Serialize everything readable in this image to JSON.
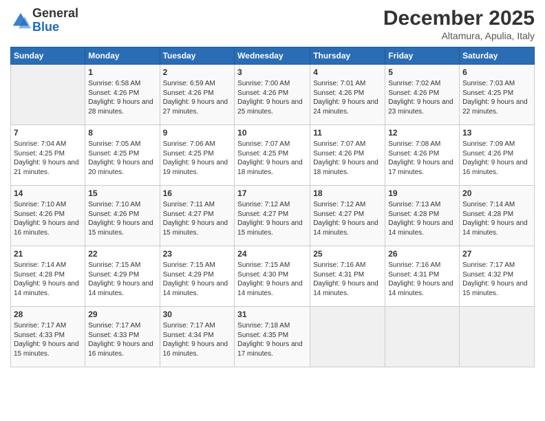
{
  "logo": {
    "general": "General",
    "blue": "Blue"
  },
  "title": "December 2025",
  "location": "Altamura, Apulia, Italy",
  "days_header": [
    "Sunday",
    "Monday",
    "Tuesday",
    "Wednesday",
    "Thursday",
    "Friday",
    "Saturday"
  ],
  "weeks": [
    [
      {
        "day": "",
        "sunrise": "",
        "sunset": "",
        "daylight": ""
      },
      {
        "day": "1",
        "sunrise": "Sunrise: 6:58 AM",
        "sunset": "Sunset: 4:26 PM",
        "daylight": "Daylight: 9 hours and 28 minutes."
      },
      {
        "day": "2",
        "sunrise": "Sunrise: 6:59 AM",
        "sunset": "Sunset: 4:26 PM",
        "daylight": "Daylight: 9 hours and 27 minutes."
      },
      {
        "day": "3",
        "sunrise": "Sunrise: 7:00 AM",
        "sunset": "Sunset: 4:26 PM",
        "daylight": "Daylight: 9 hours and 25 minutes."
      },
      {
        "day": "4",
        "sunrise": "Sunrise: 7:01 AM",
        "sunset": "Sunset: 4:26 PM",
        "daylight": "Daylight: 9 hours and 24 minutes."
      },
      {
        "day": "5",
        "sunrise": "Sunrise: 7:02 AM",
        "sunset": "Sunset: 4:26 PM",
        "daylight": "Daylight: 9 hours and 23 minutes."
      },
      {
        "day": "6",
        "sunrise": "Sunrise: 7:03 AM",
        "sunset": "Sunset: 4:25 PM",
        "daylight": "Daylight: 9 hours and 22 minutes."
      }
    ],
    [
      {
        "day": "7",
        "sunrise": "Sunrise: 7:04 AM",
        "sunset": "Sunset: 4:25 PM",
        "daylight": "Daylight: 9 hours and 21 minutes."
      },
      {
        "day": "8",
        "sunrise": "Sunrise: 7:05 AM",
        "sunset": "Sunset: 4:25 PM",
        "daylight": "Daylight: 9 hours and 20 minutes."
      },
      {
        "day": "9",
        "sunrise": "Sunrise: 7:06 AM",
        "sunset": "Sunset: 4:25 PM",
        "daylight": "Daylight: 9 hours and 19 minutes."
      },
      {
        "day": "10",
        "sunrise": "Sunrise: 7:07 AM",
        "sunset": "Sunset: 4:25 PM",
        "daylight": "Daylight: 9 hours and 18 minutes."
      },
      {
        "day": "11",
        "sunrise": "Sunrise: 7:07 AM",
        "sunset": "Sunset: 4:26 PM",
        "daylight": "Daylight: 9 hours and 18 minutes."
      },
      {
        "day": "12",
        "sunrise": "Sunrise: 7:08 AM",
        "sunset": "Sunset: 4:26 PM",
        "daylight": "Daylight: 9 hours and 17 minutes."
      },
      {
        "day": "13",
        "sunrise": "Sunrise: 7:09 AM",
        "sunset": "Sunset: 4:26 PM",
        "daylight": "Daylight: 9 hours and 16 minutes."
      }
    ],
    [
      {
        "day": "14",
        "sunrise": "Sunrise: 7:10 AM",
        "sunset": "Sunset: 4:26 PM",
        "daylight": "Daylight: 9 hours and 16 minutes."
      },
      {
        "day": "15",
        "sunrise": "Sunrise: 7:10 AM",
        "sunset": "Sunset: 4:26 PM",
        "daylight": "Daylight: 9 hours and 15 minutes."
      },
      {
        "day": "16",
        "sunrise": "Sunrise: 7:11 AM",
        "sunset": "Sunset: 4:27 PM",
        "daylight": "Daylight: 9 hours and 15 minutes."
      },
      {
        "day": "17",
        "sunrise": "Sunrise: 7:12 AM",
        "sunset": "Sunset: 4:27 PM",
        "daylight": "Daylight: 9 hours and 15 minutes."
      },
      {
        "day": "18",
        "sunrise": "Sunrise: 7:12 AM",
        "sunset": "Sunset: 4:27 PM",
        "daylight": "Daylight: 9 hours and 14 minutes."
      },
      {
        "day": "19",
        "sunrise": "Sunrise: 7:13 AM",
        "sunset": "Sunset: 4:28 PM",
        "daylight": "Daylight: 9 hours and 14 minutes."
      },
      {
        "day": "20",
        "sunrise": "Sunrise: 7:14 AM",
        "sunset": "Sunset: 4:28 PM",
        "daylight": "Daylight: 9 hours and 14 minutes."
      }
    ],
    [
      {
        "day": "21",
        "sunrise": "Sunrise: 7:14 AM",
        "sunset": "Sunset: 4:28 PM",
        "daylight": "Daylight: 9 hours and 14 minutes."
      },
      {
        "day": "22",
        "sunrise": "Sunrise: 7:15 AM",
        "sunset": "Sunset: 4:29 PM",
        "daylight": "Daylight: 9 hours and 14 minutes."
      },
      {
        "day": "23",
        "sunrise": "Sunrise: 7:15 AM",
        "sunset": "Sunset: 4:29 PM",
        "daylight": "Daylight: 9 hours and 14 minutes."
      },
      {
        "day": "24",
        "sunrise": "Sunrise: 7:15 AM",
        "sunset": "Sunset: 4:30 PM",
        "daylight": "Daylight: 9 hours and 14 minutes."
      },
      {
        "day": "25",
        "sunrise": "Sunrise: 7:16 AM",
        "sunset": "Sunset: 4:31 PM",
        "daylight": "Daylight: 9 hours and 14 minutes."
      },
      {
        "day": "26",
        "sunrise": "Sunrise: 7:16 AM",
        "sunset": "Sunset: 4:31 PM",
        "daylight": "Daylight: 9 hours and 14 minutes."
      },
      {
        "day": "27",
        "sunrise": "Sunrise: 7:17 AM",
        "sunset": "Sunset: 4:32 PM",
        "daylight": "Daylight: 9 hours and 15 minutes."
      }
    ],
    [
      {
        "day": "28",
        "sunrise": "Sunrise: 7:17 AM",
        "sunset": "Sunset: 4:33 PM",
        "daylight": "Daylight: 9 hours and 15 minutes."
      },
      {
        "day": "29",
        "sunrise": "Sunrise: 7:17 AM",
        "sunset": "Sunset: 4:33 PM",
        "daylight": "Daylight: 9 hours and 16 minutes."
      },
      {
        "day": "30",
        "sunrise": "Sunrise: 7:17 AM",
        "sunset": "Sunset: 4:34 PM",
        "daylight": "Daylight: 9 hours and 16 minutes."
      },
      {
        "day": "31",
        "sunrise": "Sunrise: 7:18 AM",
        "sunset": "Sunset: 4:35 PM",
        "daylight": "Daylight: 9 hours and 17 minutes."
      },
      {
        "day": "",
        "sunrise": "",
        "sunset": "",
        "daylight": ""
      },
      {
        "day": "",
        "sunrise": "",
        "sunset": "",
        "daylight": ""
      },
      {
        "day": "",
        "sunrise": "",
        "sunset": "",
        "daylight": ""
      }
    ]
  ]
}
